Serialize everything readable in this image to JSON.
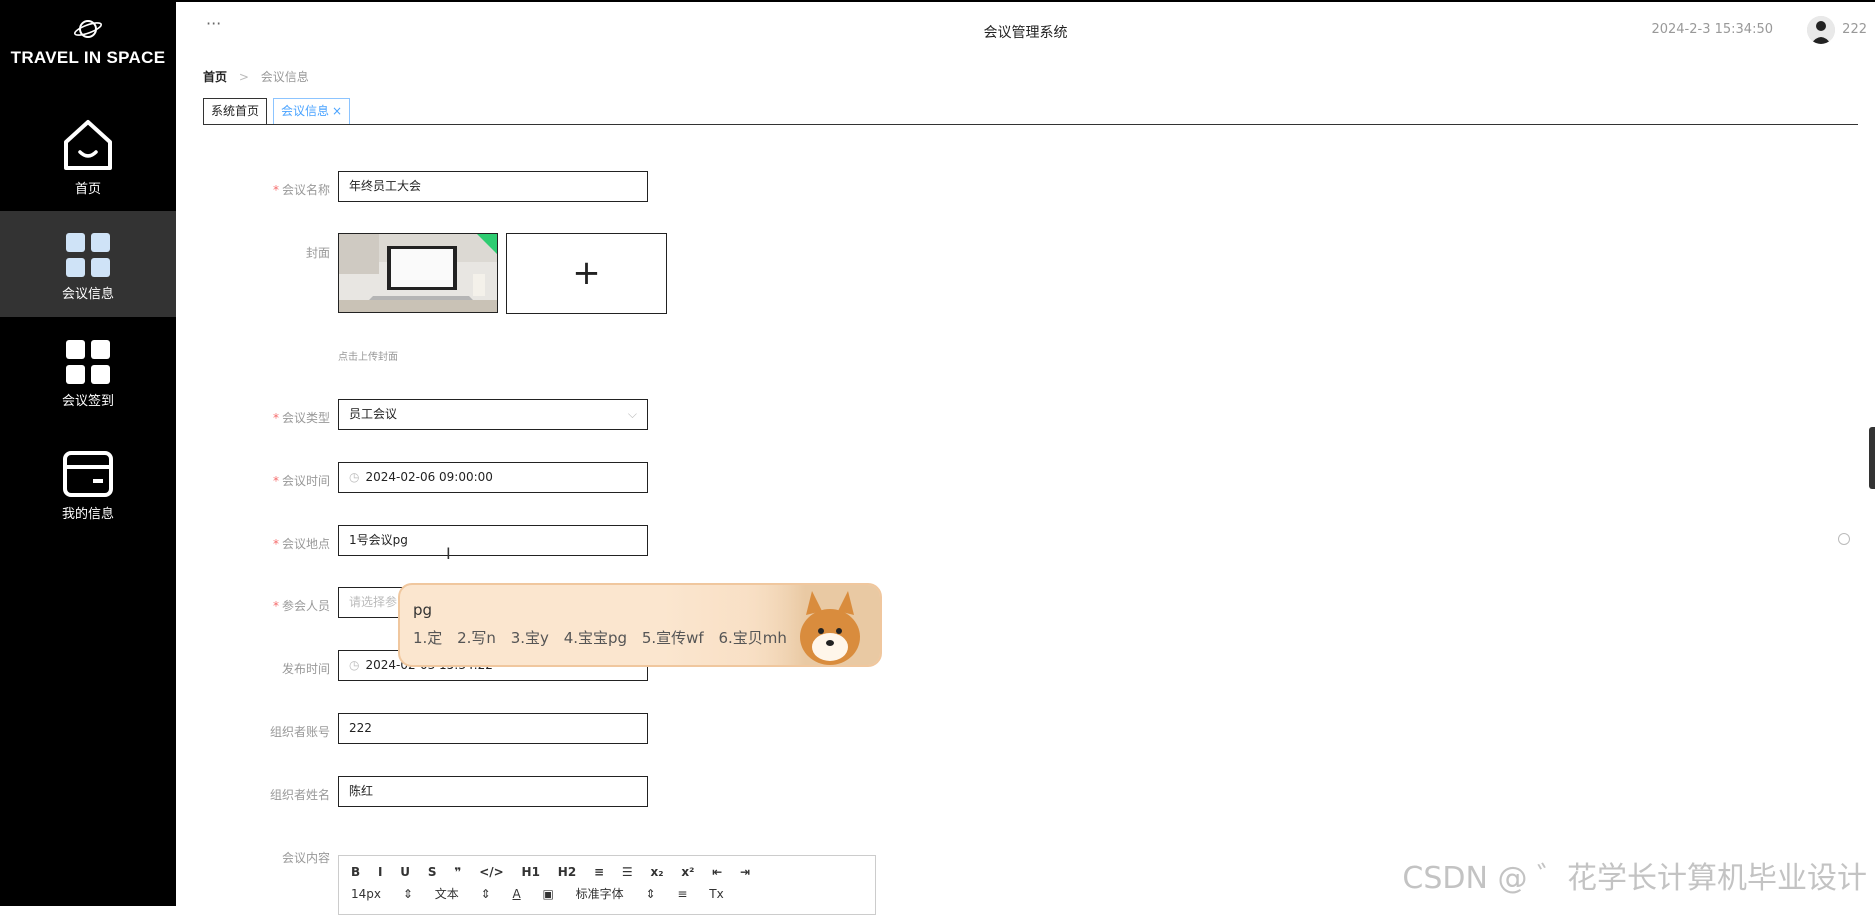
{
  "sidebar": {
    "logo_text": "TRAVEL IN SPACE",
    "items": [
      {
        "label": "首页",
        "icon": "home-icon"
      },
      {
        "label": "会议信息",
        "icon": "grid-icon"
      },
      {
        "label": "会议签到",
        "icon": "grid-icon"
      },
      {
        "label": "我的信息",
        "icon": "card-icon"
      }
    ]
  },
  "header": {
    "more": "···",
    "title": "会议管理系统",
    "datetime": "2024-2-3 15:34:50",
    "username": "222"
  },
  "breadcrumb": {
    "home": "首页",
    "sep": ">",
    "current": "会议信息"
  },
  "tabs": [
    {
      "label": "系统首页"
    },
    {
      "label": "会议信息",
      "close": "×"
    }
  ],
  "form": {
    "name": {
      "label": "会议名称",
      "value": "年终员工大会",
      "required": "*"
    },
    "cover": {
      "label": "封面",
      "add": "+",
      "hint": "点击上传封面"
    },
    "type": {
      "label": "会议类型",
      "value": "员工会议",
      "required": "*"
    },
    "time": {
      "label": "会议时间",
      "value": "2024-02-06 09:00:00",
      "required": "*"
    },
    "location": {
      "label": "会议地点",
      "value": "1号会议pg",
      "required": "*"
    },
    "attendees": {
      "label": "参会人员",
      "placeholder": "请选择参",
      "required": "*"
    },
    "publish_time": {
      "label": "发布时间",
      "value": "2024-02-03 15:34:22"
    },
    "organizer_account": {
      "label": "组织者账号",
      "value": "222"
    },
    "organizer_name": {
      "label": "组织者姓名",
      "value": "陈红"
    },
    "content": {
      "label": "会议内容"
    }
  },
  "editor": {
    "toolbar1": [
      "B",
      "I",
      "U",
      "S",
      "❞",
      "</>",
      "H1",
      "H2",
      "≡",
      "☰",
      "x₂",
      "x²",
      "⇤",
      "⇥"
    ],
    "font_size": "14px",
    "block_type": "文本",
    "font_family": "标准字体"
  },
  "ime": {
    "code": "pg",
    "candidates": [
      "1.定",
      "2.写n",
      "3.宝y",
      "4.宝宝pg",
      "5.宣传wf",
      "6.宝贝mh"
    ]
  },
  "watermark": "CSDN @ ゛花学长计算机毕业设计",
  "colors": {
    "sidebar_bg": "#000000",
    "active_item_bg": "#333333",
    "accent": "#4aa3ff",
    "required": "#f56c6c"
  }
}
